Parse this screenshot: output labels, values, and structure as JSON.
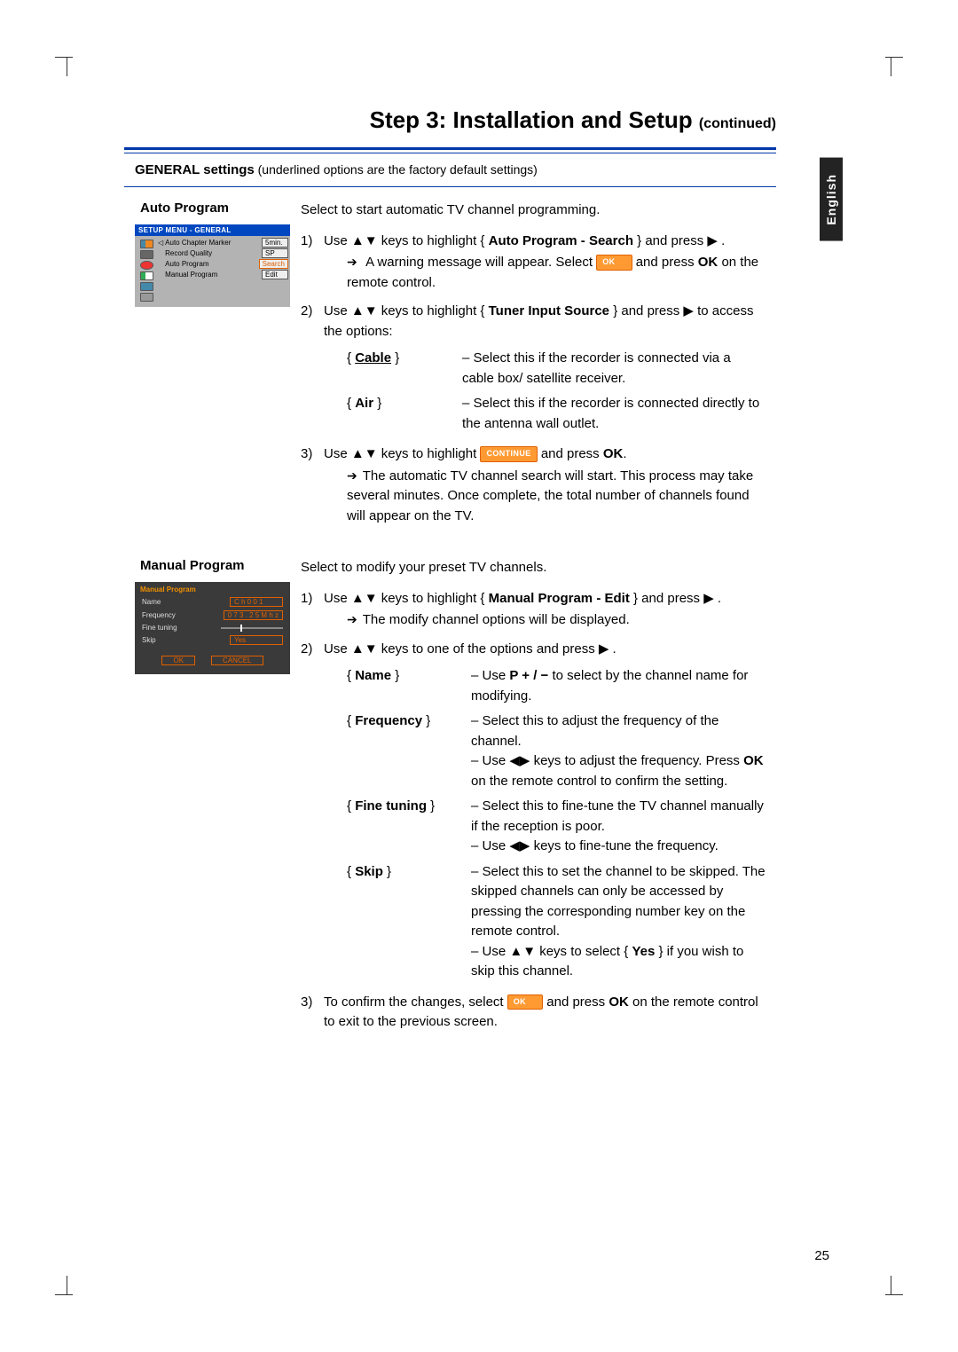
{
  "page": {
    "title_main": "Step 3: Installation and Setup",
    "title_suffix": "(continued)",
    "lang_tab": "English",
    "number": "25"
  },
  "settings_bar": {
    "title": "GENERAL settings",
    "note": "(underlined options are the factory default settings)"
  },
  "auto_program": {
    "title": "Auto Program",
    "intro": "Select to start automatic TV channel programming.",
    "step1_a": "Use ▲▼ keys to highlight { ",
    "step1_b": "Auto Program - Search",
    "step1_c": " } and press ▶ .",
    "step1_sub_a": "A warning message will appear. Select ",
    "step1_sub_b": " and press ",
    "step1_sub_c": "OK",
    "step1_sub_d": " on the remote control.",
    "step2_a": "Use ▲▼ keys to highlight { ",
    "step2_b": "Tuner Input Source",
    "step2_c": " } and press ▶ to access the options:",
    "opt_cable_label": "Cable",
    "opt_cable_desc": "– Select this if the recorder is connected via a cable box/ satellite receiver.",
    "opt_air_label": "Air",
    "opt_air_desc": "– Select this if the recorder is connected directly to the antenna wall outlet.",
    "step3_a": "Use ▲▼ keys to highlight ",
    "step3_b": " and press ",
    "step3_c": "OK",
    "step3_d": ".",
    "step3_sub": "The automatic TV channel search will start. This process may take several minutes. Once complete, the total number of channels found  will appear on the TV.",
    "btn_ok": "OK",
    "btn_continue": "CONTINUE"
  },
  "manual_program": {
    "title": "Manual Program",
    "intro": "Select to modify your preset TV channels.",
    "step1_a": "Use ▲▼ keys to highlight { ",
    "step1_b": "Manual Program - Edit",
    "step1_c": " } and press ▶ .",
    "step1_sub": "The modify channel options will be displayed.",
    "step2": "Use ▲▼ keys to one of the options and press ▶ .",
    "opt_name_label": "Name",
    "opt_name_desc_a": "– Use ",
    "opt_name_desc_b": "P  + / −",
    "opt_name_desc_c": "  to select by the channel name for modifying.",
    "opt_freq_label": "Frequency",
    "opt_freq_desc": "– Select this to adjust the frequency of the channel.\n– Use ◀▶ keys to adjust the frequency. Press OK on  the remote control to confirm the setting.",
    "opt_ft_label": "Fine tuning",
    "opt_ft_desc": "– Select this to fine-tune the TV channel manually if the reception is poor.\n– Use ◀▶ keys to fine-tune the frequency.",
    "opt_skip_label": "Skip",
    "opt_skip_desc": "– Select this to set the channel to be skipped. The skipped channels can only be accessed by pressing the corresponding number key on the remote control.\n– Use ▲▼ keys to select { Yes } if you wish to skip this channel.",
    "step3_a": "To confirm the changes, select ",
    "step3_b": " and press ",
    "step3_c": "OK",
    "step3_d": " on the remote control to exit to the previous screen.",
    "btn_ok": "OK"
  },
  "osd1": {
    "title": "SETUP MENU - GENERAL",
    "rows": [
      {
        "label": "Auto Chapter Marker",
        "value": "5min."
      },
      {
        "label": "Record Quality",
        "value": "SP"
      },
      {
        "label": "Auto Program",
        "value": "Search"
      },
      {
        "label": "Manual Program",
        "value": "Edit"
      }
    ]
  },
  "osd2": {
    "title": "Manual Program",
    "rows": {
      "name_label": "Name",
      "name_value": "C h 0 0 1",
      "freq_label": "Frequency",
      "freq_value": "0 7 3 . 2 5 M h z",
      "ft_label": "Fine tuning",
      "skip_label": "Skip",
      "skip_value": "Yes"
    },
    "btn_ok": "OK",
    "btn_cancel": "CANCEL"
  }
}
